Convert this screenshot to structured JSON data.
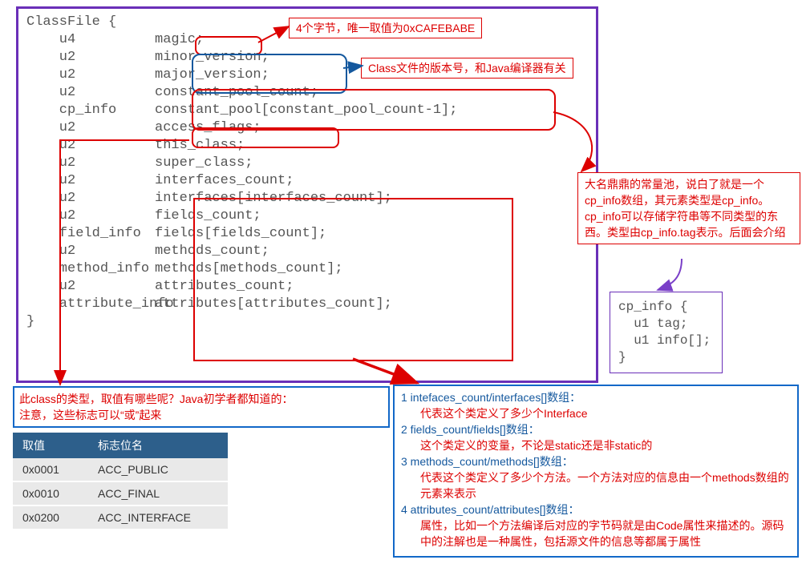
{
  "classfile": {
    "open": "ClassFile {",
    "rows": [
      {
        "type": "u4",
        "name": "magic;"
      },
      {
        "type": "u2",
        "name": "minor_version;"
      },
      {
        "type": "u2",
        "name": "major_version;"
      },
      {
        "type": "u2",
        "name": "constant_pool_count;"
      },
      {
        "type": "cp_info",
        "name": "constant_pool[constant_pool_count-1];"
      },
      {
        "type": "u2",
        "name": "access_flags;"
      },
      {
        "type": "u2",
        "name": "this_class;"
      },
      {
        "type": "u2",
        "name": "super_class;"
      },
      {
        "type": "u2",
        "name": "interfaces_count;"
      },
      {
        "type": "u2",
        "name": "interfaces[interfaces_count];"
      },
      {
        "type": "u2",
        "name": "fields_count;"
      },
      {
        "type": "field_info",
        "name": "fields[fields_count];"
      },
      {
        "type": "u2",
        "name": "methods_count;"
      },
      {
        "type": "method_info",
        "name": "methods[methods_count];"
      },
      {
        "type": "u2",
        "name": "attributes_count;"
      },
      {
        "type": "attribute_info",
        "name": "attributes[attributes_count];"
      }
    ],
    "close": "}"
  },
  "callout_magic": "4个字节，唯一取值为0xCAFEBABE",
  "callout_version": "Class文件的版本号，和Java编译器有关",
  "callout_cpool": "大名鼎鼎的常量池，说白了就是一个cp_info数组，其元素类型是cp_info。cp_info可以存储字符串等不同类型的东西。类型由cp_info.tag表示。后面会介绍",
  "cpinfo": {
    "open": "cp_info {",
    "l1": "  u1 tag;",
    "l2": "  u1 info[];",
    "close": "}"
  },
  "access_note": "此class的类型，取值有哪些呢？Java初学者都知道的：\n注意，这些标志可以“或”起来",
  "flag_table": {
    "h1": "取值",
    "h2": "标志位名",
    "rows": [
      {
        "v": "0x0001",
        "n": "ACC_PUBLIC"
      },
      {
        "v": "0x0010",
        "n": "ACC_FINAL"
      },
      {
        "v": "0x0200",
        "n": "ACC_INTERFACE"
      }
    ]
  },
  "bigblue": {
    "i1h": "1 intefaces_count/interfaces[]数组：",
    "i1b": "代表这个类定义了多少个Interface",
    "i2h": "2 fields_count/fields[]数组：",
    "i2b": "这个类定义的变量，不论是static还是非static的",
    "i3h": "3 methods_count/methods[]数组：",
    "i3b": "代表这个类定义了多少个方法。一个方法对应的信息由一个methods数组的元素来表示",
    "i4h": "4 attributes_count/attributes[]数组：",
    "i4b": "属性，比如一个方法编译后对应的字节码就是由Code属性来描述的。源码中的注解也是一种属性，包括源文件的信息等都属于属性"
  }
}
